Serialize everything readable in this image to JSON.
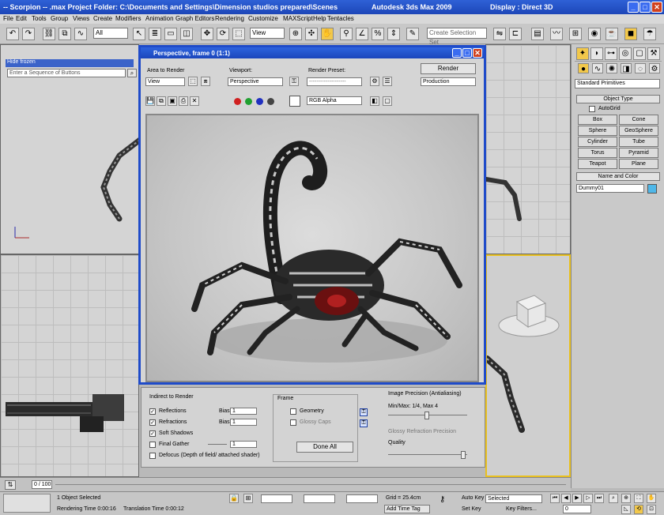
{
  "app": {
    "title": "-- Scorpion -- .max     Project Folder: C:\\Documents and Settings\\Dimension studios prepared\\Scenes",
    "product": "Autodesk 3ds Max  2009",
    "display": "Display : Direct 3D"
  },
  "menu": [
    "File",
    "Edit",
    "Tools",
    "Group",
    "Views",
    "Create",
    "Modifiers",
    "Animation",
    "Graph Editors",
    "Rendering",
    "Customize",
    "MAXScript",
    "Help",
    "Tentacles"
  ],
  "toolbar": {
    "filter_select": "All",
    "view_select": "View",
    "selection_set_placeholder": "Create Selection Set"
  },
  "viewports": {
    "top_left_search": "Enter a Sequence of Buttons",
    "top_left_link": "Hide frozen"
  },
  "render_window": {
    "title": "Perspective, frame 0 (1:1)",
    "area_label": "Area to Render",
    "area_value": "View",
    "viewport_label": "Viewport:",
    "viewport_value": "Perspective",
    "preset_label": "Render Preset:",
    "preset_value": "--------------------",
    "render_button": "Render",
    "production_value": "Production",
    "channel_value": "RGB Alpha"
  },
  "render_options": {
    "group1_title": "Indirect to Render",
    "reflections": "Reflections",
    "refractions": "Refractions",
    "soft_shadows": "Soft Shadows",
    "final_gather": "Final Gather",
    "defocus": "Defocus (Depth of field/ attached shader)",
    "spin_label1": "Bias",
    "spin_label2": "Bias",
    "spin_value": "1",
    "group2_title": "Frame",
    "geometry": "Geometry",
    "glossy_caps": "Glossy Caps",
    "done_button": "Done All",
    "group3_title": "Image Precision (Antialiasing)",
    "min_max": "Min/Max: 1/4, Max 4",
    "glossy_precision": "Glossy Refraction Precision",
    "quality": "Quality"
  },
  "command_panel": {
    "dropdown": "Standard Primitives",
    "object_type": "Object Type",
    "autogrid": "AutoGrid",
    "buttons": [
      "Box",
      "Cone",
      "Sphere",
      "GeoSphere",
      "Cylinder",
      "Tube",
      "Torus",
      "Pyramid",
      "Teapot",
      "Plane"
    ],
    "name_color": "Name and Color",
    "name_field": "Dummy01",
    "accent_color": "#4fb7e8"
  },
  "timeline": {
    "frame_counter": "0 / 100"
  },
  "status": {
    "selected": "1 Object Selected",
    "render_time": "Rendering Time  0:00:16",
    "translation_time": "Translation Time  0:00:12",
    "grid": "Grid = 25.4cm",
    "add_time_tag": "Add Time Tag",
    "auto_key": "Auto Key",
    "selected_dropdown": "Selected",
    "set_key": "Set Key",
    "key_filters": "Key Filters...",
    "frame_field": "0"
  }
}
